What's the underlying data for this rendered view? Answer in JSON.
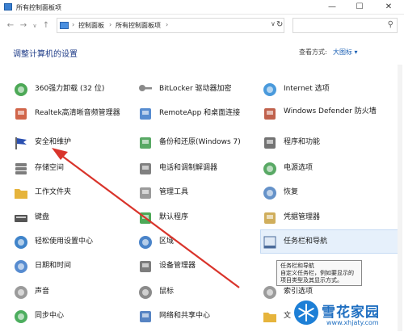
{
  "window": {
    "title": "所有控制面板项",
    "minimize": "—",
    "maximize": "☐",
    "close": "✕"
  },
  "nav": {
    "back": "←",
    "forward": "→",
    "up_menu": "∨",
    "up": "↑"
  },
  "address": {
    "crumbs": [
      "控制面板",
      "所有控制面板项"
    ],
    "separator": "›",
    "dropdown": "∨",
    "refresh": "↻",
    "search_placeholder": ""
  },
  "main": {
    "heading": "调整计算机的设置",
    "view_by_label": "查看方式:",
    "view_by_value": "大图标 ▾"
  },
  "items": [
    {
      "label": "360强力卸载 (32 位)",
      "icon": "uninstall-icon",
      "col": 1,
      "row": 1
    },
    {
      "label": "Realtek高清晰音频管理器",
      "icon": "speaker-icon",
      "col": 1,
      "row": 2
    },
    {
      "label": "安全和维护",
      "icon": "flag-icon",
      "col": 1,
      "row": 3
    },
    {
      "label": "存储空间",
      "icon": "storage-icon",
      "col": 1,
      "row": 4
    },
    {
      "label": "工作文件夹",
      "icon": "folder-icon",
      "col": 1,
      "row": 5
    },
    {
      "label": "键盘",
      "icon": "keyboard-icon",
      "col": 1,
      "row": 6
    },
    {
      "label": "轻松使用设置中心",
      "icon": "ease-of-access-icon",
      "col": 1,
      "row": 7
    },
    {
      "label": "日期和时间",
      "icon": "clock-icon",
      "col": 1,
      "row": 8
    },
    {
      "label": "声音",
      "icon": "sound-icon",
      "col": 1,
      "row": 9
    },
    {
      "label": "同步中心",
      "icon": "sync-icon",
      "col": 1,
      "row": 10
    },
    {
      "label": "BitLocker 驱动器加密",
      "icon": "key-icon",
      "col": 2,
      "row": 1
    },
    {
      "label": "RemoteApp 和桌面连接",
      "icon": "remote-desktop-icon",
      "col": 2,
      "row": 2
    },
    {
      "label": "备份和还原(Windows 7)",
      "icon": "backup-icon",
      "col": 2,
      "row": 3
    },
    {
      "label": "电话和调制解调器",
      "icon": "phone-icon",
      "col": 2,
      "row": 4
    },
    {
      "label": "管理工具",
      "icon": "admin-tools-icon",
      "col": 2,
      "row": 5
    },
    {
      "label": "默认程序",
      "icon": "default-programs-icon",
      "col": 2,
      "row": 6
    },
    {
      "label": "区域",
      "icon": "globe-icon",
      "col": 2,
      "row": 7
    },
    {
      "label": "设备管理器",
      "icon": "device-manager-icon",
      "col": 2,
      "row": 8
    },
    {
      "label": "鼠标",
      "icon": "mouse-icon",
      "col": 2,
      "row": 9
    },
    {
      "label": "网络和共享中心",
      "icon": "network-icon",
      "col": 2,
      "row": 10
    },
    {
      "label": "Internet 选项",
      "icon": "internet-icon",
      "col": 3,
      "row": 1
    },
    {
      "label": "Windows Defender 防火墙",
      "icon": "firewall-icon",
      "col": 3,
      "row": 2
    },
    {
      "label": "程序和功能",
      "icon": "programs-icon",
      "col": 3,
      "row": 3
    },
    {
      "label": "电源选项",
      "icon": "power-icon",
      "col": 3,
      "row": 4
    },
    {
      "label": "恢复",
      "icon": "recovery-icon",
      "col": 3,
      "row": 5
    },
    {
      "label": "凭据管理器",
      "icon": "credential-icon",
      "col": 3,
      "row": 6
    },
    {
      "label": "任务栏和导航",
      "icon": "taskbar-icon",
      "col": 3,
      "row": 7
    },
    {
      "label": "索引选项",
      "icon": "index-icon",
      "col": 3,
      "row": 9
    },
    {
      "label": "文",
      "icon": "file-icon",
      "col": 3,
      "row": 10
    }
  ],
  "tooltip": {
    "title": "任务栏和导航",
    "text": "自定义任务栏，例如要显示的项目类型及其显示方式。"
  },
  "watermark": {
    "title": "雪花家园",
    "url": "www.xhjaty.com"
  },
  "colors": {
    "heading": "#1f3c88",
    "accent": "#1a5fb4",
    "highlight": "#e6f0fb",
    "arrow": "#d9342b"
  }
}
